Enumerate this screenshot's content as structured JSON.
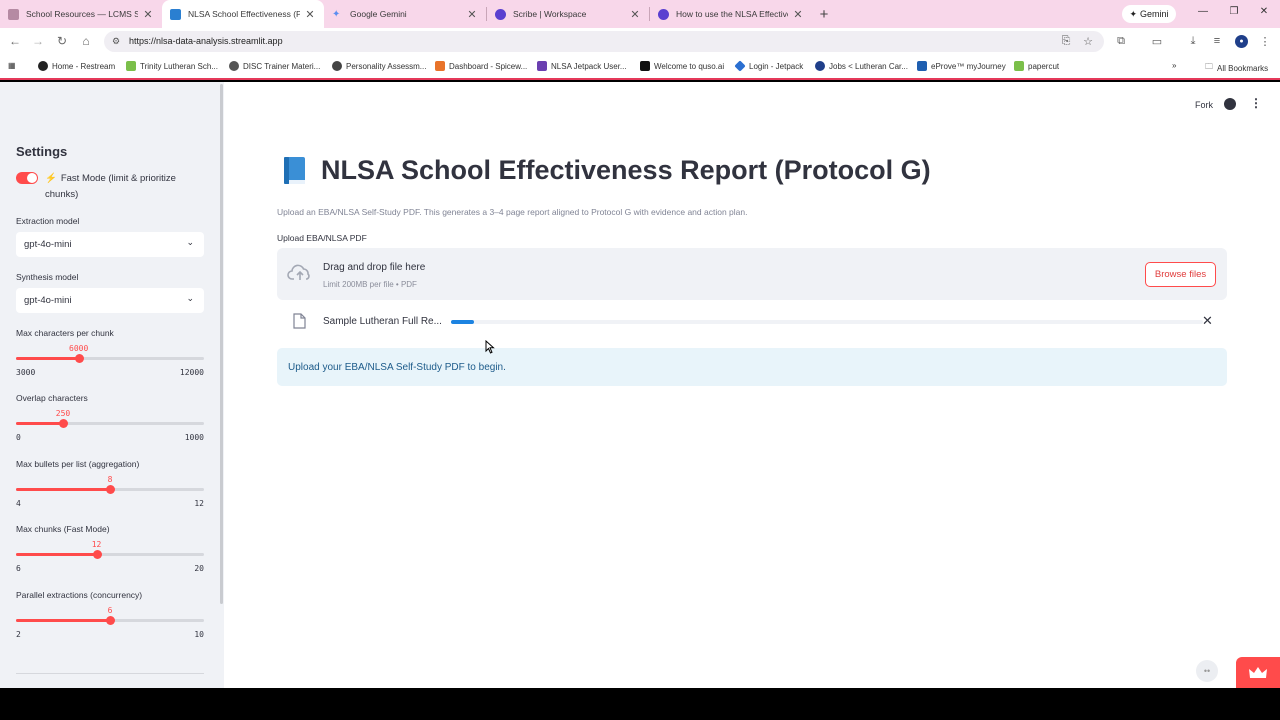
{
  "browser": {
    "tabs": [
      {
        "title": "School Resources — LCMS Schools",
        "color": "#b58aa3"
      },
      {
        "title": "NLSA School Effectiveness (Protocol G)",
        "color": "#2a7fd1",
        "active": true
      },
      {
        "title": "Google Gemini",
        "color": "#5b8ef0"
      },
      {
        "title": "Scribe | Workspace",
        "color": "#5a3fd0"
      },
      {
        "title": "How to use the NLSA Effectiveness",
        "color": "#5a3fd0"
      }
    ],
    "gemini_label": "Gemini",
    "url": "https://nlsa-data-analysis.streamlit.app",
    "bookmarks": [
      {
        "label": "Home - Restream",
        "color": "#222"
      },
      {
        "label": "Trinity Lutheran Sch...",
        "color": "#7bbf4a"
      },
      {
        "label": "DISC Trainer Materi...",
        "color": "#555"
      },
      {
        "label": "Personality Assessm...",
        "color": "#444"
      },
      {
        "label": "Dashboard - Spicew...",
        "color": "#e8732a"
      },
      {
        "label": "NLSA Jetpack User...",
        "color": "#6a3fb0"
      },
      {
        "label": "Welcome to quso.ai",
        "color": "#111"
      },
      {
        "label": "Login - Jetpack",
        "color": "#2a6fd1"
      },
      {
        "label": "Jobs < Lutheran Car...",
        "color": "#1f3f8a"
      },
      {
        "label": "eProve™ myJourney",
        "color": "#1f5fb0"
      },
      {
        "label": "papercut",
        "color": "#7bbf4a"
      }
    ],
    "all_bookmarks_label": "All Bookmarks"
  },
  "sidebar": {
    "title": "Settings",
    "fast_mode_label": "Fast Mode (limit & prioritize chunks)",
    "fast_mode_on": true,
    "extraction_model_label": "Extraction model",
    "extraction_model_value": "gpt-4o-mini",
    "synthesis_model_label": "Synthesis model",
    "synthesis_model_value": "gpt-4o-mini",
    "sliders": [
      {
        "label": "Max characters per chunk",
        "value": 6000,
        "min": 3000,
        "max": 12000
      },
      {
        "label": "Overlap characters",
        "value": 250,
        "min": 0,
        "max": 1000
      },
      {
        "label": "Max bullets per list (aggregation)",
        "value": 8,
        "min": 4,
        "max": 12
      },
      {
        "label": "Max chunks (Fast Mode)",
        "value": 12,
        "min": 6,
        "max": 20
      },
      {
        "label": "Parallel extractions (concurrency)",
        "value": 6,
        "min": 2,
        "max": 10
      }
    ]
  },
  "header": {
    "fork_label": "Fork"
  },
  "main": {
    "title": "NLSA School Effectiveness Report (Protocol G)",
    "subtitle": "Upload an EBA/NLSA Self-Study PDF. This generates a 3–4 page report aligned to Protocol G with evidence and action plan.",
    "upload_label": "Upload EBA/NLSA PDF",
    "drop_text": "Drag and drop file here",
    "limit_text": "Limit 200MB per file • PDF",
    "browse_label": "Browse files",
    "file_name": "Sample Lutheran Full Re...",
    "upload_progress": 0.03,
    "info_text": "Upload your EBA/NLSA Self-Study PDF to begin."
  },
  "colors": {
    "accent": "#ff4b4b",
    "progress": "#1c83e1",
    "info_bg": "#e8f4fa",
    "info_text": "#1d5b8a"
  }
}
